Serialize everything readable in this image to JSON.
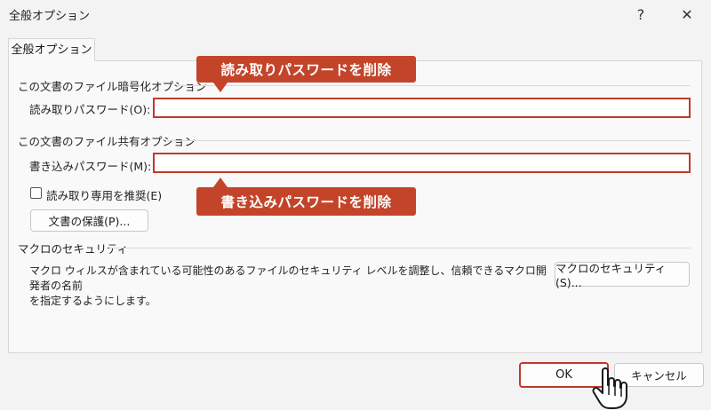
{
  "window": {
    "title": "全般オプション",
    "help_label": "?",
    "close_label": "✕"
  },
  "tab": {
    "label": "全般オプション"
  },
  "encrypt_section": {
    "heading": "この文書のファイル暗号化オプション",
    "password_label": "読み取りパスワード(O):",
    "password_value": ""
  },
  "share_section": {
    "heading": "この文書のファイル共有オプション",
    "password_label": "書き込みパスワード(M):",
    "password_value": "",
    "readonly_label": "読み取り専用を推奨(E)",
    "readonly_checked": false,
    "protect_button": "文書の保護(P)..."
  },
  "macro_section": {
    "heading": "マクロのセキュリティ",
    "description_line1": "マクロ ウィルスが含まれている可能性のあるファイルのセキュリティ レベルを調整し、信頼できるマクロ開発者の名前",
    "description_line2": "を指定するようにします。",
    "button": "マクロのセキュリティ(S)..."
  },
  "footer": {
    "ok_label": "OK",
    "cancel_label": "キャンセル"
  },
  "annotations": {
    "read_callout": "読み取りパスワードを削除",
    "write_callout": "書き込みパスワードを削除"
  },
  "colors": {
    "accent": "#c4442a",
    "border_highlight": "#c0392b"
  }
}
